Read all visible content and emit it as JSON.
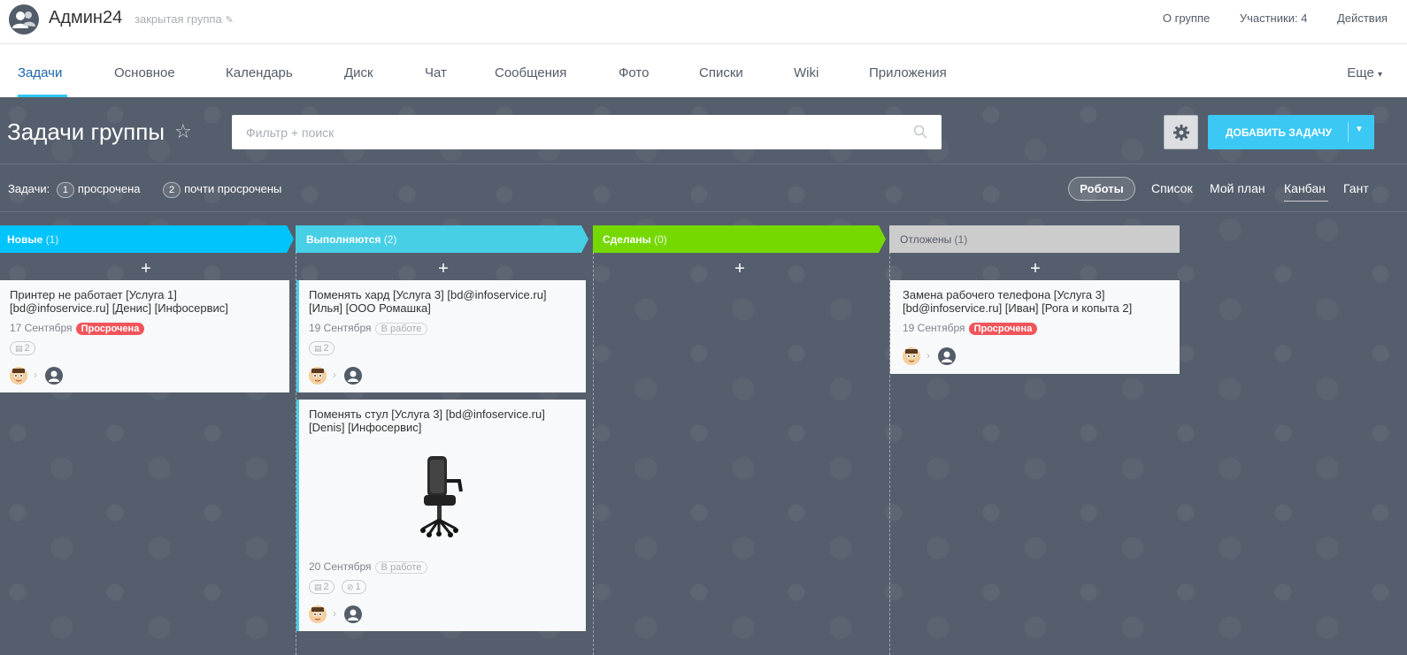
{
  "header": {
    "group_title": "Админ24",
    "group_subtitle": "закрытая группа",
    "links": [
      "О группе",
      "Участники: 4",
      "Действия"
    ]
  },
  "tabs": {
    "items": [
      "Задачи",
      "Основное",
      "Календарь",
      "Диск",
      "Чат",
      "Сообщения",
      "Фото",
      "Списки",
      "Wiki",
      "Приложения"
    ],
    "more": "Еще"
  },
  "toolbar": {
    "page_title": "Задачи группы",
    "search_placeholder": "Фильтр + поиск",
    "add_button": "ДОБАВИТЬ ЗАДАЧУ"
  },
  "counters": {
    "prefix": "Задачи:",
    "items": [
      {
        "count": "1",
        "label": "просрочена"
      },
      {
        "count": "2",
        "label": "почти просрочены"
      }
    ]
  },
  "views": {
    "robots": "Роботы",
    "items": [
      "Список",
      "Мой план",
      "Канбан",
      "Гант"
    ],
    "active": "Канбан"
  },
  "columns": [
    {
      "title": "Новые",
      "count": "(1)",
      "color": "#00c4fb"
    },
    {
      "title": "Выполняются",
      "count": "(2)",
      "color": "#47cfe5"
    },
    {
      "title": "Сделаны",
      "count": "(0)",
      "color": "#75d900"
    },
    {
      "title": "Отложены",
      "count": "(1)",
      "color": "#cccccc"
    }
  ],
  "cards": [
    {
      "title": "Принтер не работает [Услуга 1] [bd@infoservice.ru] [Денис] [Инфосервис]",
      "date": "17 Сентября",
      "status": "Просрочена",
      "comments": "2"
    },
    {
      "title": "Поменять хард [Услуга 3] [bd@infoservice.ru] [Илья] [ООО Ромашка]",
      "date": "19 Сентября",
      "status": "В работе",
      "comments": "2"
    },
    {
      "title": "Поменять стул [Услуга 3] [bd@infoservice.ru] [Denis] [Инфосервис]",
      "date": "20 Сентября",
      "status": "В работе",
      "comments": "2",
      "files": "1"
    },
    {
      "title": "Замена рабочего телефона [Услуга 3] [bd@infoservice.ru] [Иван] [Рога и копыта 2]",
      "date": "19 Сентября",
      "status": "Просрочена"
    }
  ],
  "colors": {
    "accent": "#3bc8f5",
    "overdue": "#f0555a",
    "background": "#555e6c"
  }
}
